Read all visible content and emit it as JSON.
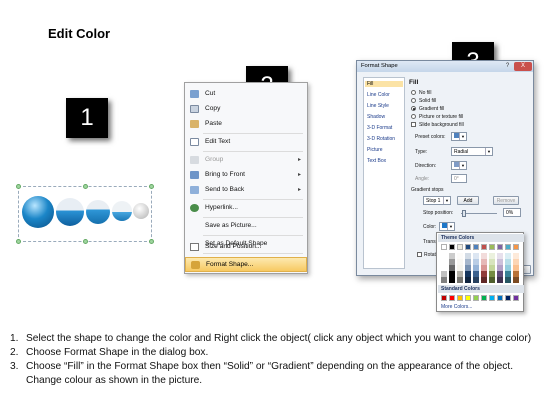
{
  "title": "Edit Color",
  "badges": [
    "1",
    "2",
    "3"
  ],
  "context_menu": {
    "items": [
      {
        "label": "Cut",
        "icon": "scissors-icon"
      },
      {
        "label": "Copy",
        "icon": "copy-icon"
      },
      {
        "label": "Paste",
        "icon": "paste-icon"
      },
      {
        "label": "Edit Text",
        "icon": "edit-text-icon"
      },
      {
        "label": "Group",
        "icon": "group-icon",
        "disabled": true,
        "submenu": true
      },
      {
        "label": "Bring to Front",
        "icon": "bring-to-front-icon",
        "submenu": true
      },
      {
        "label": "Send to Back",
        "icon": "send-to-back-icon",
        "submenu": true
      },
      {
        "label": "Hyperlink...",
        "icon": "hyperlink-icon"
      },
      {
        "label": "Save as Picture..."
      },
      {
        "label": "Set as Default Shape"
      },
      {
        "label": "Size and Position...",
        "icon": "size-position-icon"
      },
      {
        "label": "Format Shape...",
        "icon": "format-shape-icon",
        "highlighted": true
      }
    ]
  },
  "dialog": {
    "title": "Format Shape",
    "help": "?",
    "close": "X",
    "nav": [
      "Fill",
      "Line Color",
      "Line Style",
      "Shadow",
      "3-D Format",
      "3-D Rotation",
      "Picture",
      "Text Box"
    ],
    "heading": "Fill",
    "fill_options": [
      "No fill",
      "Solid fill",
      "Gradient fill",
      "Picture or texture fill",
      "Slide background fill"
    ],
    "selected_fill": "Gradient fill",
    "preset_colors_label": "Preset colors:",
    "type_label": "Type:",
    "type_value": "Radial",
    "direction_label": "Direction:",
    "angle_label": "Angle:",
    "angle_value": "0°",
    "gradient_stops_label": "Gradient stops",
    "stop_value": "Stop 1",
    "add_label": "Add",
    "remove_label": "Remove",
    "stop_position_label": "Stop position:",
    "stop_position_value": "0%",
    "color_label": "Color:",
    "transparency_label": "Transpa",
    "rotate_label": "Rotate",
    "close_button": "Close"
  },
  "picker": {
    "theme_heading": "Theme Colors",
    "standard_heading": "Standard Colors",
    "more_label": "More Colors...",
    "theme_top": [
      "#ffffff",
      "#000000",
      "#eeece1",
      "#1f497d",
      "#4f81bd",
      "#c0504d",
      "#9bbb59",
      "#8064a2",
      "#4bacc6",
      "#f79646"
    ],
    "standard": [
      "#c00000",
      "#ff0000",
      "#ffc000",
      "#ffff00",
      "#92d050",
      "#00b050",
      "#00b0f0",
      "#0070c0",
      "#002060",
      "#7030a0"
    ]
  },
  "steps": [
    {
      "num": "1.",
      "text": "Select the shape to change the color and Right click the object( click any object which you want to change color)"
    },
    {
      "num": "2.",
      "text": "Choose Format Shape in the dialog box."
    },
    {
      "num": "3.",
      "text": "Choose “Fill” in the Format Shape box then “Solid” or “Gradient” depending on the appearance of the object. Change colour as shown in the picture."
    }
  ]
}
